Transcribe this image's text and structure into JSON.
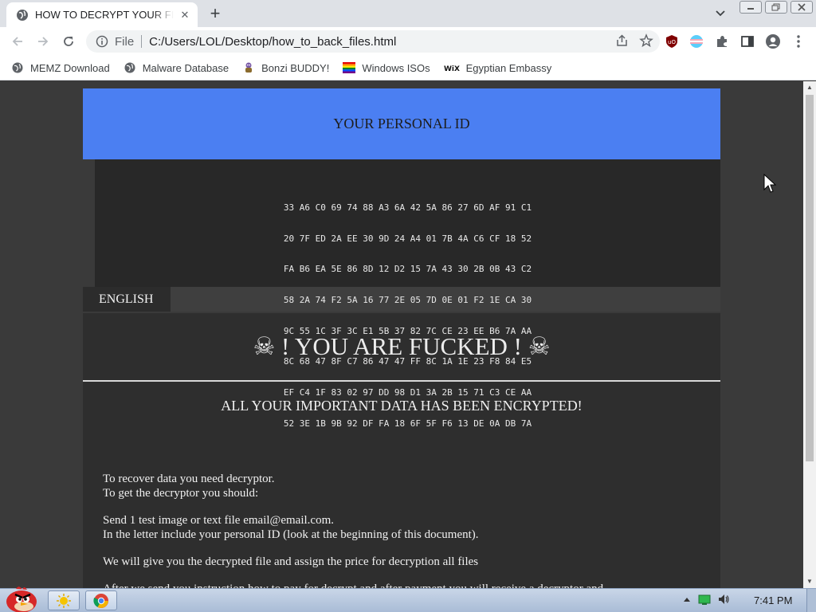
{
  "browser": {
    "tab_title": "HOW TO DECRYPT YOUR FILES",
    "tab_close": "✕",
    "new_tab": "+",
    "scheme_label": "File",
    "url": "C:/Users/LOL/Desktop/how_to_back_files.html",
    "bookmarks": [
      {
        "label": "MEMZ Download",
        "icon": "globe-icon"
      },
      {
        "label": "Malware Database",
        "icon": "globe-icon"
      },
      {
        "label": "Bonzi BUDDY!",
        "icon": "bonzi-icon"
      },
      {
        "label": "Windows ISOs",
        "icon": "rainbow-flag-icon"
      },
      {
        "label": "Egyptian Embassy",
        "icon": "wix-icon"
      }
    ],
    "wix_logo": "WiX"
  },
  "page": {
    "id_header": "YOUR PERSONAL ID",
    "personal_id_lines": [
      "33 A6 C0 69 74 88 A3 6A 42 5A 86 27 6D AF 91 C1",
      "20 7F ED 2A EE 30 9D 24 A4 01 7B 4A C6 CF 18 52",
      "FA B6 EA 5E 86 8D 12 D2 15 7A 43 30 2B 0B 43 C2",
      "58 2A 74 F2 5A 16 77 2E 05 7D 0E 01 F2 1E CA 30",
      "9C 55 1C 3F 3C E1 5B 37 82 7C CE 23 EE B6 7A AA",
      "8C 68 47 8F C7 86 47 47 FF 8C 1A 1E 23 F8 84 E5",
      "EF C4 1F 83 02 97 DD 98 D1 3A 2B 15 71 C3 CE AA",
      "52 3E 1B 9B 92 DF FA 18 6F 5F F6 13 DE 0A DB 7A"
    ],
    "language_tab": "ENGLISH",
    "headline": "☠ ! YOU ARE FUCKED ! ☠",
    "subheadline": "ALL YOUR IMPORTANT DATA HAS BEEN ENCRYPTED!",
    "paragraphs": [
      [
        "To recover data you need decryptor.",
        "To get the decryptor you should:"
      ],
      [
        "Send 1 test image or text file email@email.com.",
        "In the letter include your personal ID (look at the beginning of this document)."
      ],
      [
        "We will give you the decrypted file and assign the price for decryption all files"
      ],
      [
        "After we send you instruction how to pay for decrypt and after payment you will receive a decryptor and"
      ]
    ]
  },
  "taskbar": {
    "clock": "7:41 PM"
  },
  "colors": {
    "id_header_bg": "#4b7ff2",
    "page_bg": "#3a3a3a",
    "panel_bg": "#2e2e2e"
  }
}
